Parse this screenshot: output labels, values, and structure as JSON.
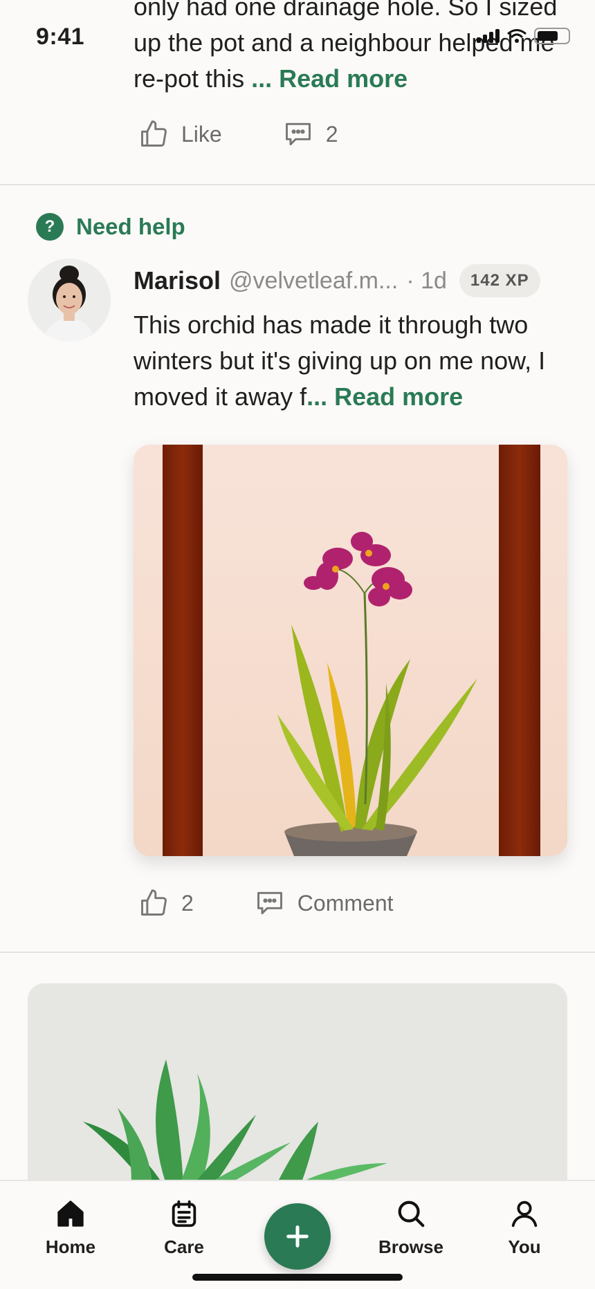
{
  "status_bar": {
    "time": "9:41"
  },
  "previous_post": {
    "text_line_1": "only had one drainage hole. So I sized",
    "text_line_2": "up the pot and a neighbour helped me",
    "text_line_3": "re-pot this ",
    "read_more": "... Read more",
    "like_label": "Like",
    "comment_count": "2"
  },
  "post": {
    "category_icon": "?",
    "category": "Need help",
    "author_name": "Marisol",
    "author_handle": "@velvetleaf.m...",
    "age": "· 1d",
    "xp_badge": "142 XP",
    "text": "This orchid has made it through two winters but it's giving up on me now, I moved it away f",
    "read_more": "... Read more",
    "like_count": "2",
    "comment_label": "Comment"
  },
  "bottom_nav": {
    "items": [
      {
        "label": "Home",
        "icon": "home-icon"
      },
      {
        "label": "Care",
        "icon": "calendar-icon"
      },
      {
        "label": "Browse",
        "icon": "search-icon"
      },
      {
        "label": "You",
        "icon": "person-icon"
      }
    ],
    "fab_icon": "plus-icon"
  },
  "colors": {
    "accent": "#2a7a55",
    "background": "#fbfaf8"
  }
}
